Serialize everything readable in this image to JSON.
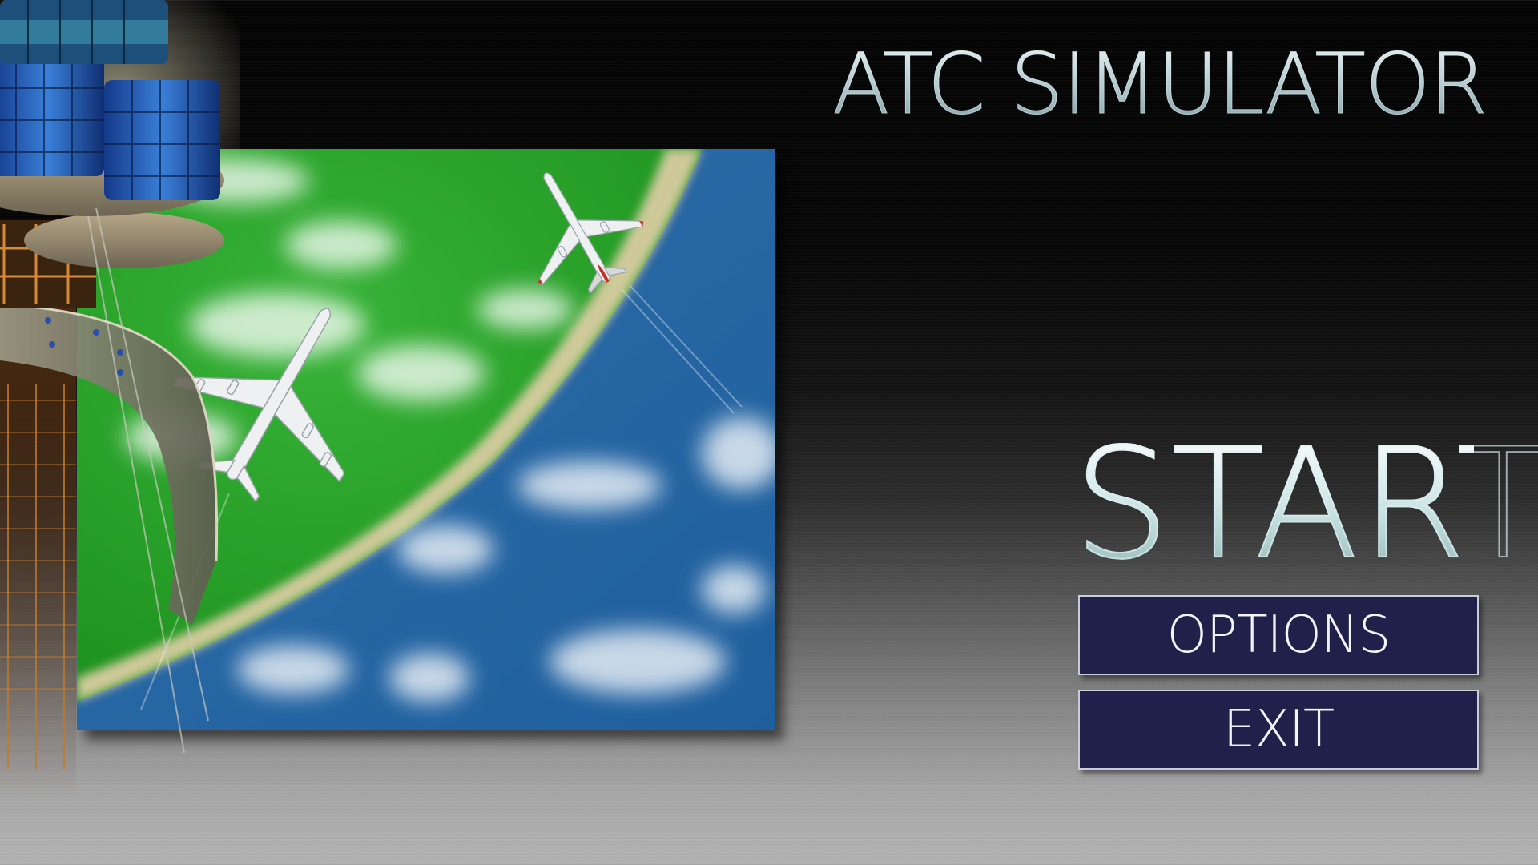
{
  "game": {
    "title": "ATC SIMULATOR"
  },
  "menu": {
    "start_label": "START",
    "options_label": "OPTIONS",
    "exit_label": "EXIT"
  },
  "colors": {
    "button_fill": "#20204a",
    "button_border": "#c9cdda",
    "land": "#2aa52a",
    "sea": "#2a6aa6",
    "beach": "#d9cca0"
  },
  "illustration": {
    "subjects": [
      "control-tower",
      "airliner",
      "airliner",
      "coastline",
      "clouds"
    ]
  }
}
